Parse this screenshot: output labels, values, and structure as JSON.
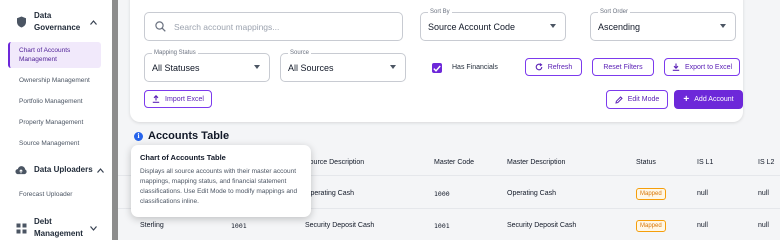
{
  "sidebar": {
    "groups": [
      {
        "label": "Data Governance",
        "icon": "shield-icon",
        "chevron": "^"
      },
      {
        "label": "Data Uploaders",
        "icon": "cloud-upload-icon",
        "chevron": "^"
      },
      {
        "label": "Debt Management",
        "icon": "grid-icon",
        "chevron": "v"
      }
    ],
    "items": [
      {
        "label": "Chart of Accounts Management",
        "active": true
      },
      {
        "label": "Ownership Management"
      },
      {
        "label": "Portfolio Management"
      },
      {
        "label": "Property Management"
      },
      {
        "label": "Source Management"
      },
      {
        "label": "Forecast Uploader"
      }
    ]
  },
  "filters": {
    "search_placeholder": "Search account mappings...",
    "sort_by": {
      "label": "Sort By",
      "value": "Source Account Code"
    },
    "sort_order": {
      "label": "Sort Order",
      "value": "Ascending"
    },
    "mapping_status": {
      "label": "Mapping Status",
      "value": "All Statuses"
    },
    "source": {
      "label": "Source",
      "value": "All Sources"
    },
    "has_financials": {
      "label": "Has Financials",
      "checked": true
    },
    "refresh_label": "Refresh",
    "reset_label": "Reset Filters",
    "export_label": "Export to Excel",
    "import_label": "Import Excel",
    "edit_mode_label": "Edit Mode",
    "add_account_label": "Add Account"
  },
  "table": {
    "title": "Accounts Table",
    "columns": [
      "Source Description",
      "Master Code",
      "Master Description",
      "Status",
      "IS L1",
      "IS L2"
    ],
    "rows": [
      {
        "source": "",
        "code": "",
        "source_desc": "Operating Cash",
        "master_code": "1000",
        "master_desc": "Operating Cash",
        "status": "Mapped",
        "is_l1": "null",
        "is_l2": "null"
      },
      {
        "source": "Sterling",
        "code": "1001",
        "source_desc": "Security Deposit Cash",
        "master_code": "1001",
        "master_desc": "Security Deposit Cash",
        "status": "Mapped",
        "is_l1": "null",
        "is_l2": "null"
      }
    ]
  },
  "tooltip": {
    "title": "Chart of Accounts Table",
    "body": "Displays all source accounts with their master account mappings, mapping status, and financial statement classifications. Use Edit Mode to modify mappings and classifications inline."
  },
  "colors": {
    "accent": "#6d28d9",
    "status_mapped": "#f59e0b",
    "info": "#2563eb"
  }
}
